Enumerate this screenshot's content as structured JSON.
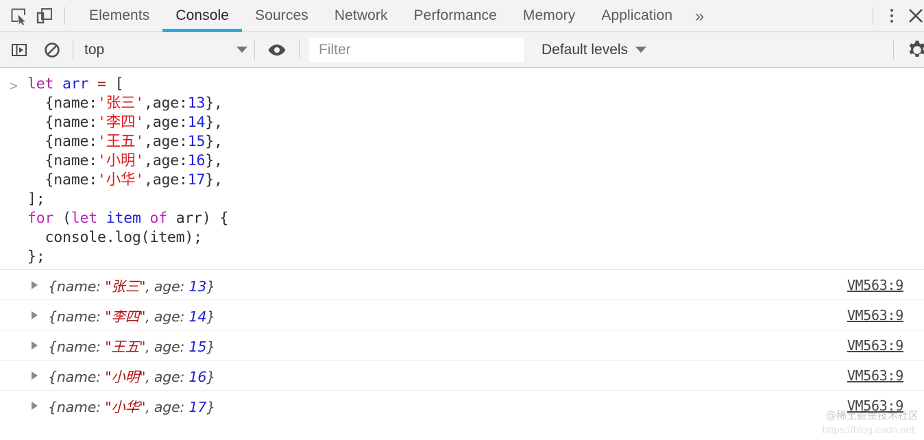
{
  "theme": {
    "accent": "#2ca8de",
    "toolbar_bg": "#f3f3f3",
    "console_bg": "#ffffff",
    "string_color": "#e01b1b",
    "number_color": "#2020dd",
    "keyword_color": "#aa22aa",
    "output_string_color": "#b01414",
    "link_color": "#444444"
  },
  "tabbar": {
    "inspect_icon": "inspect-element-icon",
    "device_icon": "device-toolbar-icon",
    "tabs": [
      {
        "label": "Elements",
        "active": false
      },
      {
        "label": "Console",
        "active": true
      },
      {
        "label": "Sources",
        "active": false
      },
      {
        "label": "Network",
        "active": false
      },
      {
        "label": "Performance",
        "active": false
      },
      {
        "label": "Memory",
        "active": false
      },
      {
        "label": "Application",
        "active": false
      }
    ],
    "more_tabs": "»",
    "kebab_icon": "more-options-icon",
    "close_label": "✕"
  },
  "toolbar": {
    "sidebar_toggle_icon": "console-sidebar-icon",
    "clear_icon": "clear-console-icon",
    "context_value": "top",
    "context_caret": "▼",
    "eye_icon": "live-expression-icon",
    "filter_placeholder": "Filter",
    "levels_label": "Default levels",
    "levels_caret": "▼",
    "settings_icon": "gear-icon"
  },
  "console": {
    "prompt_symbol": ">",
    "input_lines": [
      [
        {
          "t": "let",
          "c": "kw"
        },
        {
          "t": " ",
          "c": "plain"
        },
        {
          "t": "arr",
          "c": "var"
        },
        {
          "t": " ",
          "c": "plain"
        },
        {
          "t": "=",
          "c": "op"
        },
        {
          "t": " [",
          "c": "plain"
        }
      ],
      [
        {
          "t": "  {name:",
          "c": "plain"
        },
        {
          "t": "'张三'",
          "c": "str"
        },
        {
          "t": ",age:",
          "c": "plain"
        },
        {
          "t": "13",
          "c": "num"
        },
        {
          "t": "},",
          "c": "plain"
        }
      ],
      [
        {
          "t": "  {name:",
          "c": "plain"
        },
        {
          "t": "'李四'",
          "c": "str"
        },
        {
          "t": ",age:",
          "c": "plain"
        },
        {
          "t": "14",
          "c": "num"
        },
        {
          "t": "},",
          "c": "plain"
        }
      ],
      [
        {
          "t": "  {name:",
          "c": "plain"
        },
        {
          "t": "'王五'",
          "c": "str"
        },
        {
          "t": ",age:",
          "c": "plain"
        },
        {
          "t": "15",
          "c": "num"
        },
        {
          "t": "},",
          "c": "plain"
        }
      ],
      [
        {
          "t": "  {name:",
          "c": "plain"
        },
        {
          "t": "'小明'",
          "c": "str"
        },
        {
          "t": ",age:",
          "c": "plain"
        },
        {
          "t": "16",
          "c": "num"
        },
        {
          "t": "},",
          "c": "plain"
        }
      ],
      [
        {
          "t": "  {name:",
          "c": "plain"
        },
        {
          "t": "'小华'",
          "c": "str"
        },
        {
          "t": ",age:",
          "c": "plain"
        },
        {
          "t": "17",
          "c": "num"
        },
        {
          "t": "},",
          "c": "plain"
        }
      ],
      [
        {
          "t": "];",
          "c": "plain"
        }
      ],
      [
        {
          "t": "for",
          "c": "kw2"
        },
        {
          "t": " (",
          "c": "plain"
        },
        {
          "t": "let",
          "c": "kw2"
        },
        {
          "t": " ",
          "c": "plain"
        },
        {
          "t": "item",
          "c": "var"
        },
        {
          "t": " ",
          "c": "plain"
        },
        {
          "t": "of",
          "c": "kw2"
        },
        {
          "t": " arr) {",
          "c": "plain"
        }
      ],
      [
        {
          "t": "  console.log(item);",
          "c": "plain"
        }
      ],
      [
        {
          "t": "};",
          "c": "plain"
        }
      ]
    ],
    "outputs": [
      {
        "prefix": "{name: ",
        "string": "\"张三\"",
        "mid": ", age: ",
        "number": "13",
        "suffix": "}",
        "source": "VM563:9"
      },
      {
        "prefix": "{name: ",
        "string": "\"李四\"",
        "mid": ", age: ",
        "number": "14",
        "suffix": "}",
        "source": "VM563:9"
      },
      {
        "prefix": "{name: ",
        "string": "\"王五\"",
        "mid": ", age: ",
        "number": "15",
        "suffix": "}",
        "source": "VM563:9"
      },
      {
        "prefix": "{name: ",
        "string": "\"小明\"",
        "mid": ", age: ",
        "number": "16",
        "suffix": "}",
        "source": "VM563:9"
      },
      {
        "prefix": "{name: ",
        "string": "\"小华\"",
        "mid": ", age: ",
        "number": "17",
        "suffix": "}",
        "source": "VM563:9"
      }
    ]
  },
  "watermark": {
    "text": "@稀土掘金技术社区",
    "url": "https://blog.csdn.net"
  }
}
